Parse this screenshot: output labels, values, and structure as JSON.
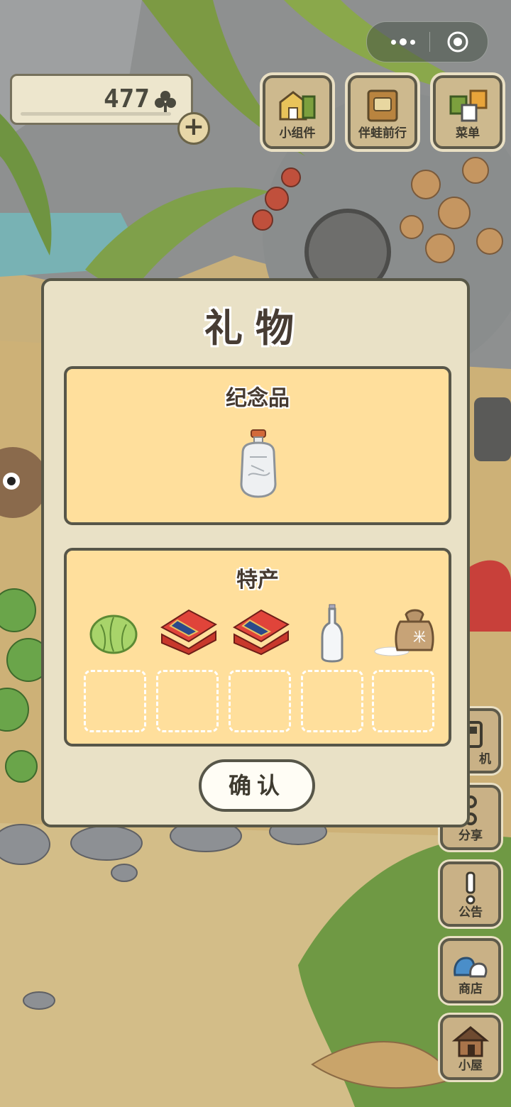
{
  "status": {
    "clovers": "477"
  },
  "capsule": {
    "more_icon": "more-dots-icon",
    "close_icon": "target-close-icon"
  },
  "top_buttons": [
    {
      "label": "小组件",
      "icon": "widget-icon"
    },
    {
      "label": "伴蛙前行",
      "icon": "travel-book-icon"
    },
    {
      "label": "菜单",
      "icon": "menu-cards-icon"
    }
  ],
  "side_buttons": [
    {
      "label": "机",
      "icon": "machine-icon"
    },
    {
      "label": "分享",
      "icon": "share-icon"
    },
    {
      "label": "公告",
      "icon": "announcement-icon"
    },
    {
      "label": "商店",
      "icon": "shop-bags-icon"
    },
    {
      "label": "小屋",
      "icon": "house-icon"
    }
  ],
  "modal": {
    "title": "礼物",
    "souvenir": {
      "title": "纪念品",
      "items": [
        "snuff-bottle-icon"
      ]
    },
    "specialty": {
      "title": "特产",
      "items": [
        "cabbage-icon",
        "gift-box-icon",
        "gift-box-icon",
        "glass-bottle-icon",
        "rice-sack-icon"
      ],
      "empty_slots": 5
    },
    "confirm_label": "确认"
  },
  "colors": {
    "panel": "#ffdf9c",
    "modal": "#e9e1c6",
    "border": "#575649"
  }
}
